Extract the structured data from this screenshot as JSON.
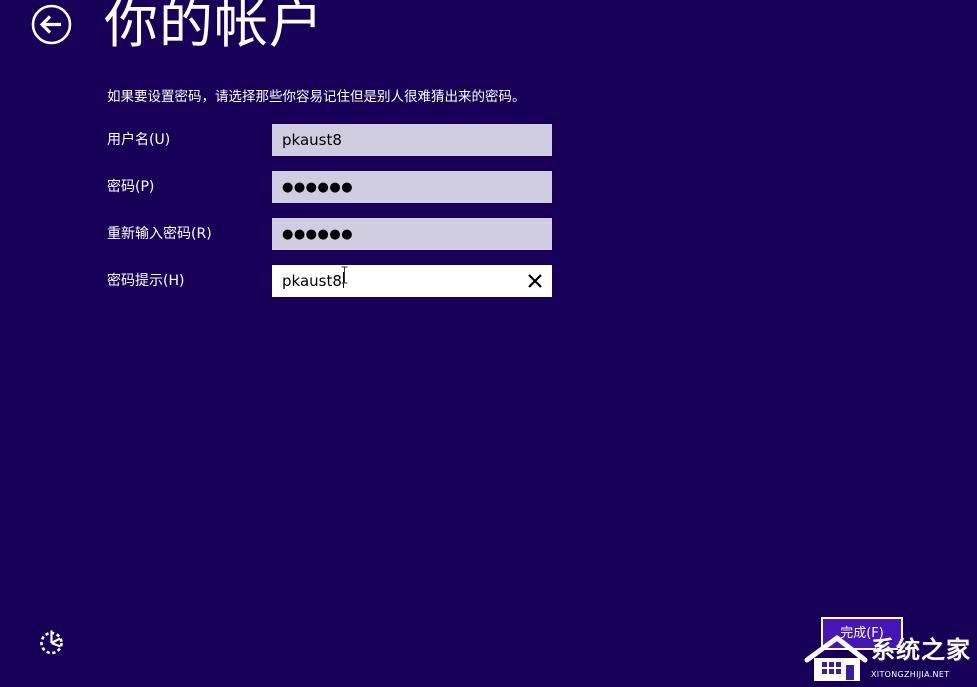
{
  "header": {
    "title": "你的帐户"
  },
  "instructions": "如果要设置密码，请选择那些你容易记住但是别人很难猜出来的密码。",
  "form": {
    "username": {
      "label": "用户名(U)",
      "value": "pkaust8"
    },
    "password": {
      "label": "密码(P)",
      "value": "●●●●●●"
    },
    "confirm_password": {
      "label": "重新输入密码(R)",
      "value": "●●●●●●"
    },
    "password_hint": {
      "label": "密码提示(H)",
      "value": "pkaust8"
    }
  },
  "footer": {
    "finish_label": "完成(F)"
  },
  "watermark": {
    "name": "系统之家",
    "url": "XITONGZHIJIA.NET"
  },
  "icons": {
    "back": "back-arrow-icon",
    "clear": "close-icon",
    "ease_of_access": "ease-of-access-icon"
  },
  "colors": {
    "background": "#180059",
    "field_inactive": "#d1cde1",
    "field_active": "#ffffff",
    "accent_button": "#4617b4",
    "text": "#ffffff"
  }
}
